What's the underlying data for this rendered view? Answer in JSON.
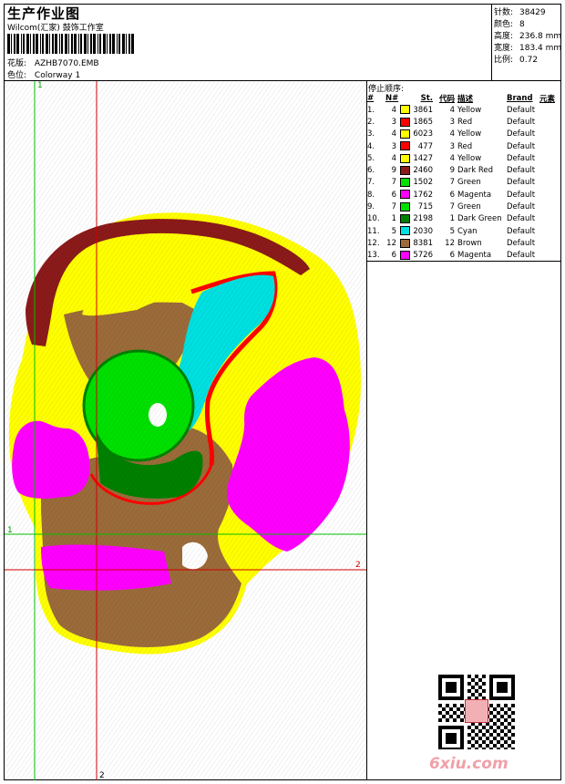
{
  "header": {
    "title": "生产作业图",
    "company": "Wilcom(汇家) 鼓饰工作室",
    "design_label": "花版:",
    "design_value": "AZHB7070.EMB",
    "colorway_label": "色位:",
    "colorway_value": "Colorway 1"
  },
  "stats": [
    {
      "label": "针数:",
      "value": "38429"
    },
    {
      "label": "颜色:",
      "value": "8"
    },
    {
      "label": "高度:",
      "value": "236.8 mm"
    },
    {
      "label": "宽度:",
      "value": "183.4 mm"
    },
    {
      "label": "比例:",
      "value": "0.72"
    }
  ],
  "stop_sequence": {
    "title": "停止顺序:",
    "headers": {
      "index": "#",
      "needle": "N#",
      "stitches": "St.",
      "code": "代码",
      "desc": "描述",
      "brand": "Brand",
      "element": "元素"
    },
    "rows": [
      {
        "index": "1.",
        "needle": "4",
        "color": "#ffff00",
        "stitches": "3861",
        "code": "4",
        "desc": "Yellow",
        "brand": "Default"
      },
      {
        "index": "2.",
        "needle": "3",
        "color": "#ff0000",
        "stitches": "1865",
        "code": "3",
        "desc": "Red",
        "brand": "Default"
      },
      {
        "index": "3.",
        "needle": "4",
        "color": "#ffff00",
        "stitches": "6023",
        "code": "4",
        "desc": "Yellow",
        "brand": "Default"
      },
      {
        "index": "4.",
        "needle": "3",
        "color": "#ff0000",
        "stitches": "477",
        "code": "3",
        "desc": "Red",
        "brand": "Default"
      },
      {
        "index": "5.",
        "needle": "4",
        "color": "#ffff00",
        "stitches": "1427",
        "code": "4",
        "desc": "Yellow",
        "brand": "Default"
      },
      {
        "index": "6.",
        "needle": "9",
        "color": "#8b1a1a",
        "stitches": "2460",
        "code": "9",
        "desc": "Dark Red",
        "brand": "Default"
      },
      {
        "index": "7.",
        "needle": "7",
        "color": "#00e000",
        "stitches": "1502",
        "code": "7",
        "desc": "Green",
        "brand": "Default"
      },
      {
        "index": "8.",
        "needle": "6",
        "color": "#ff00ff",
        "stitches": "1762",
        "code": "6",
        "desc": "Magenta",
        "brand": "Default"
      },
      {
        "index": "9.",
        "needle": "7",
        "color": "#00e000",
        "stitches": "715",
        "code": "7",
        "desc": "Green",
        "brand": "Default"
      },
      {
        "index": "10.",
        "needle": "1",
        "color": "#008000",
        "stitches": "2198",
        "code": "1",
        "desc": "Dark Green",
        "brand": "Default"
      },
      {
        "index": "11.",
        "needle": "5",
        "color": "#00e0e0",
        "stitches": "2030",
        "code": "5",
        "desc": "Cyan",
        "brand": "Default"
      },
      {
        "index": "12.",
        "needle": "12",
        "color": "#9b6b3a",
        "stitches": "8381",
        "code": "12",
        "desc": "Brown",
        "brand": "Default"
      },
      {
        "index": "13.",
        "needle": "6",
        "color": "#ff00ff",
        "stitches": "5726",
        "code": "6",
        "desc": "Magenta",
        "brand": "Default"
      }
    ]
  },
  "guides": {
    "v1": "1",
    "v2": "2",
    "h1": "1",
    "h2": "2"
  },
  "colors": {
    "yellow": "#ffff00",
    "red": "#ff0000",
    "dark_red": "#8b1a1a",
    "green": "#00e000",
    "dark_green": "#008000",
    "magenta": "#ff00ff",
    "cyan": "#00e0e0",
    "brown": "#9b6b3a",
    "guide_green": "#00c000",
    "guide_red": "#d00000"
  },
  "watermark": "6xiu.com"
}
